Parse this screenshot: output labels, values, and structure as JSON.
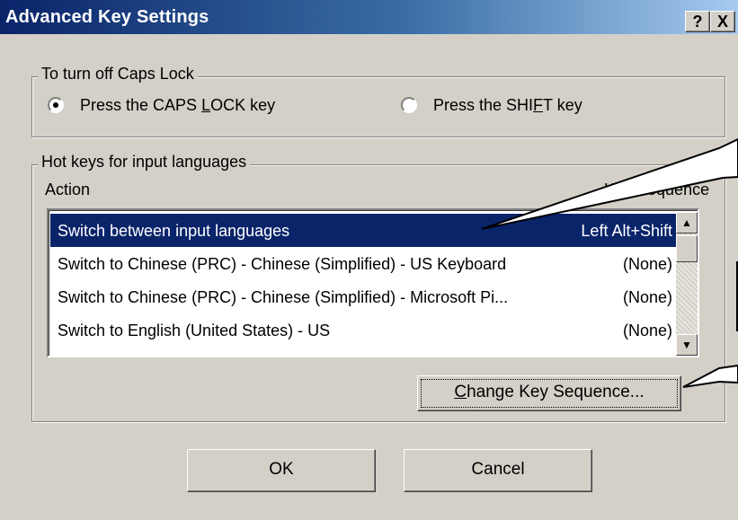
{
  "window": {
    "title": "Advanced Key Settings",
    "help_button": "?",
    "close_button": "X"
  },
  "caps_group": {
    "title": "To turn off Caps Lock",
    "option1_pre": "Press the CAPS ",
    "option1_accel": "L",
    "option1_post": "OCK key",
    "option2_pre": "Press the SHI",
    "option2_accel": "F",
    "option2_post": "T key",
    "selected": "option1"
  },
  "hotkeys_group": {
    "title": "Hot keys for input languages",
    "col_action": "Action",
    "col_key": "Key Sequence",
    "rows": [
      {
        "action": "Switch between input languages",
        "key": "Left Alt+Shift"
      },
      {
        "action": "Switch to Chinese (PRC) - Chinese (Simplified) - US Keyboard",
        "key": "(None)"
      },
      {
        "action": "Switch to Chinese (PRC) - Chinese (Simplified) - Microsoft Pi...",
        "key": "(None)"
      },
      {
        "action": "Switch to English (United States) - US",
        "key": "(None)"
      }
    ],
    "change_pre": "",
    "change_accel": "C",
    "change_post": "hange Key Sequence..."
  },
  "buttons": {
    "ok": "OK",
    "cancel": "Cancel"
  },
  "colors": {
    "selection": "#0a246a",
    "face": "#d4d0c8"
  }
}
